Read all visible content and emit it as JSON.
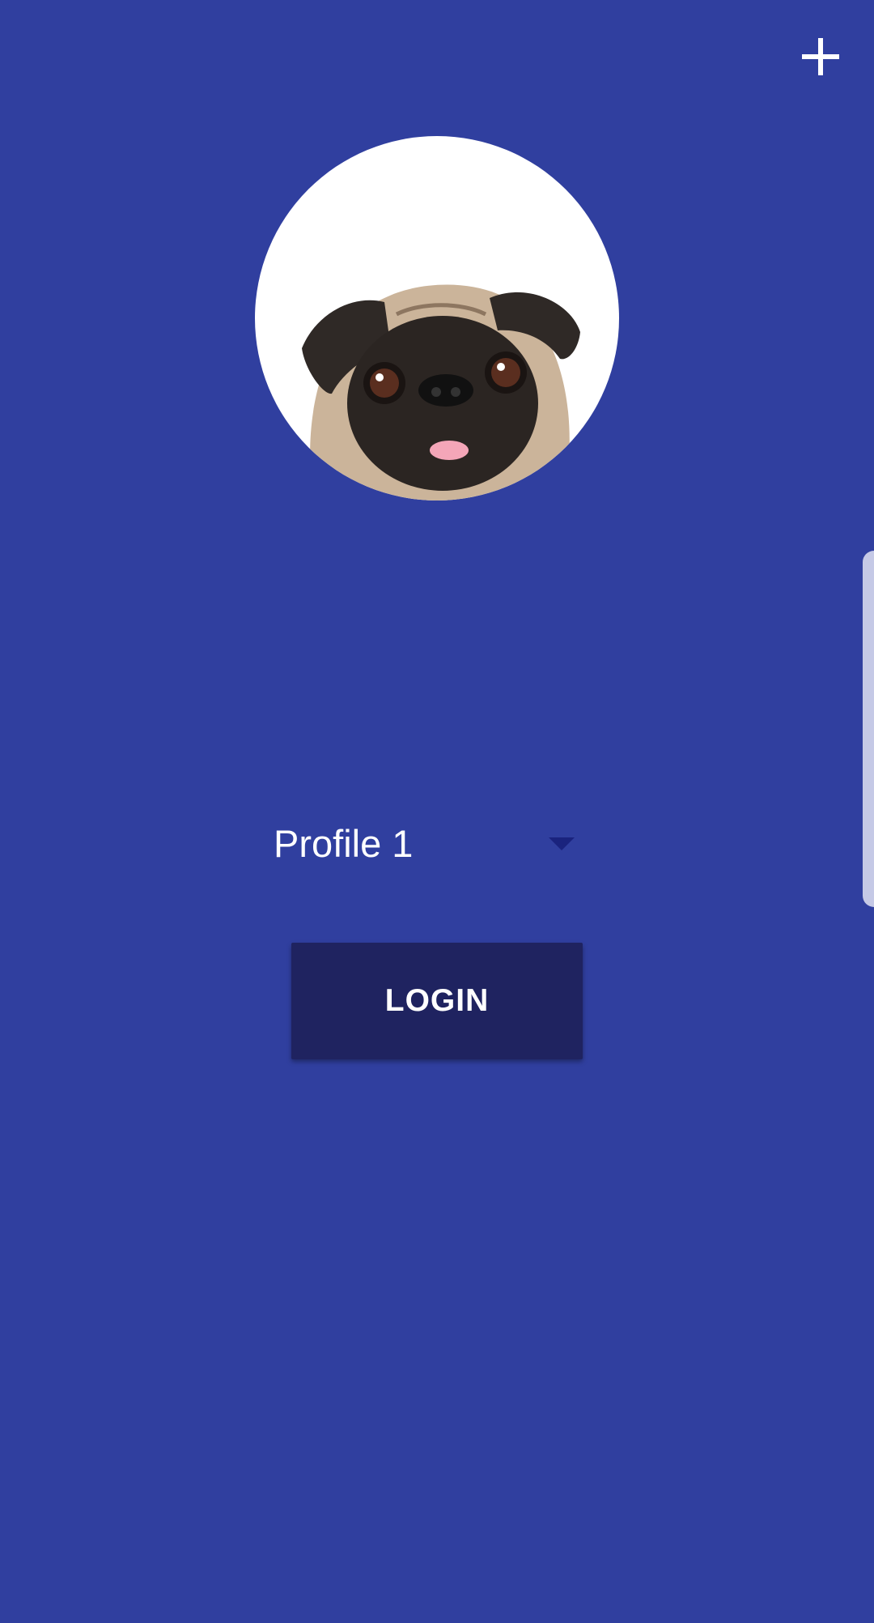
{
  "header": {
    "add_icon": "plus-icon"
  },
  "profile": {
    "avatar_image": "pug-dog-photo",
    "selected": "Profile 1",
    "dropdown_icon": "triangle-down-icon"
  },
  "actions": {
    "login_label": "LOGIN"
  },
  "colors": {
    "background": "#303f9f",
    "login_button": "#1f2360",
    "text": "#ffffff",
    "caret": "#1a237e"
  }
}
